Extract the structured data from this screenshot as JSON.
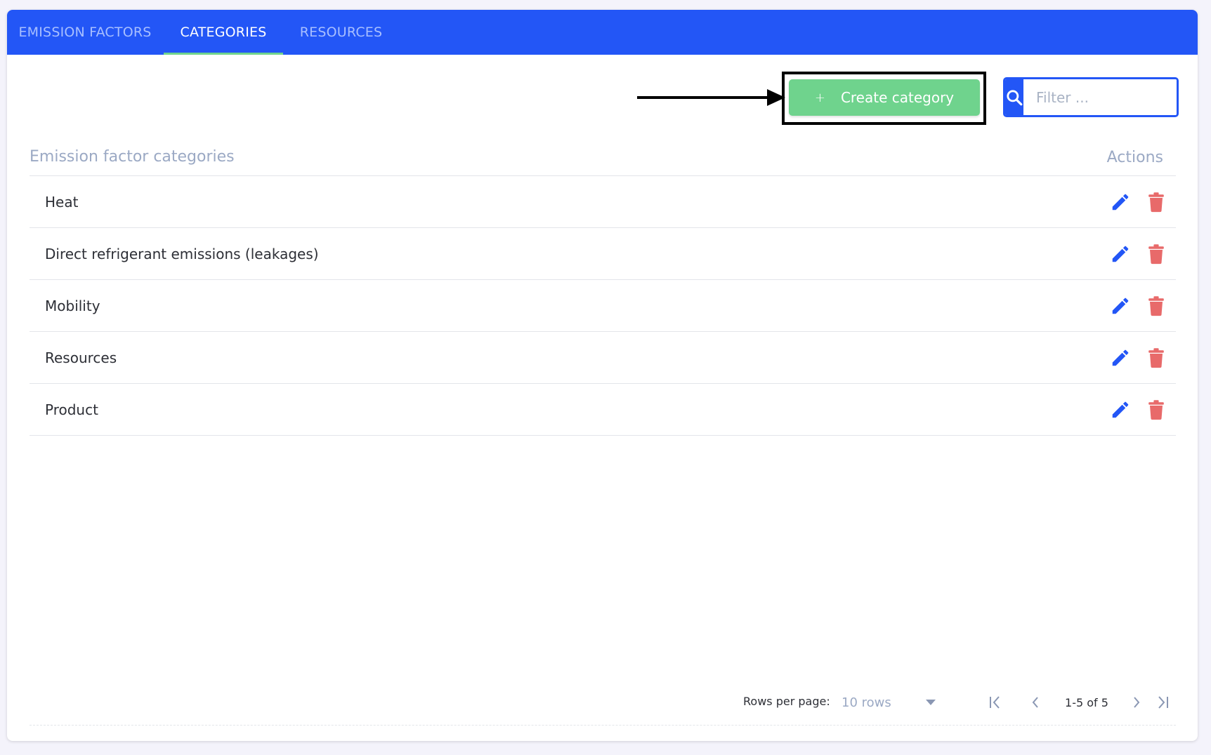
{
  "tabs": [
    {
      "label": "EMISSION FACTORS",
      "active": false
    },
    {
      "label": "CATEGORIES",
      "active": true
    },
    {
      "label": "RESOURCES",
      "active": false
    }
  ],
  "toolbar": {
    "create_icon": "plus-icon",
    "create_label": "Create category",
    "filter_placeholder": "Filter ...",
    "filter_value": ""
  },
  "table": {
    "header_name": "Emission factor categories",
    "header_actions": "Actions",
    "rows": [
      {
        "label": "Heat"
      },
      {
        "label": "Direct refrigerant emissions (leakages)"
      },
      {
        "label": "Mobility"
      },
      {
        "label": "Resources"
      },
      {
        "label": "Product"
      }
    ]
  },
  "pagination": {
    "rows_per_page_label": "Rows per page:",
    "rows_per_page_value": "10 rows",
    "range": "1-5 of 5"
  },
  "colors": {
    "primary": "#2356f6",
    "success": "#6fd38d",
    "danger": "#e86a6a",
    "muted": "#9ba9c4"
  }
}
